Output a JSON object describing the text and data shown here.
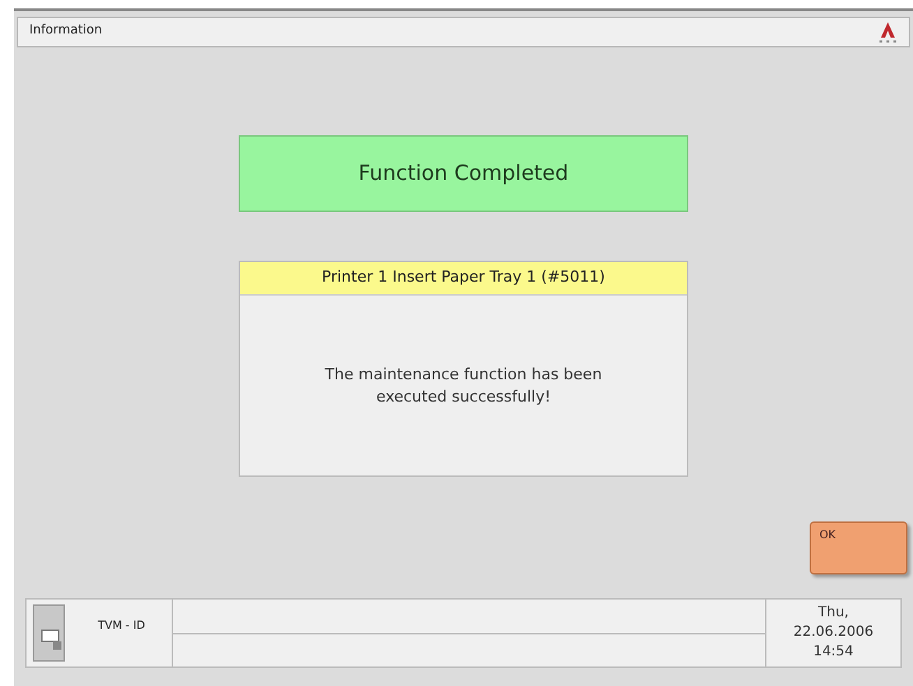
{
  "window": {
    "title": "Information"
  },
  "status": {
    "title": "Function Completed"
  },
  "message": {
    "header": "Printer 1 Insert Paper Tray 1 (#5011)",
    "body": "The maintenance function has been executed successfully!"
  },
  "buttons": [
    "OK"
  ],
  "status_bar": {
    "device_label": "TVM - ID",
    "day": "Thu,",
    "date": "22.06.2006",
    "time": "14:54"
  }
}
